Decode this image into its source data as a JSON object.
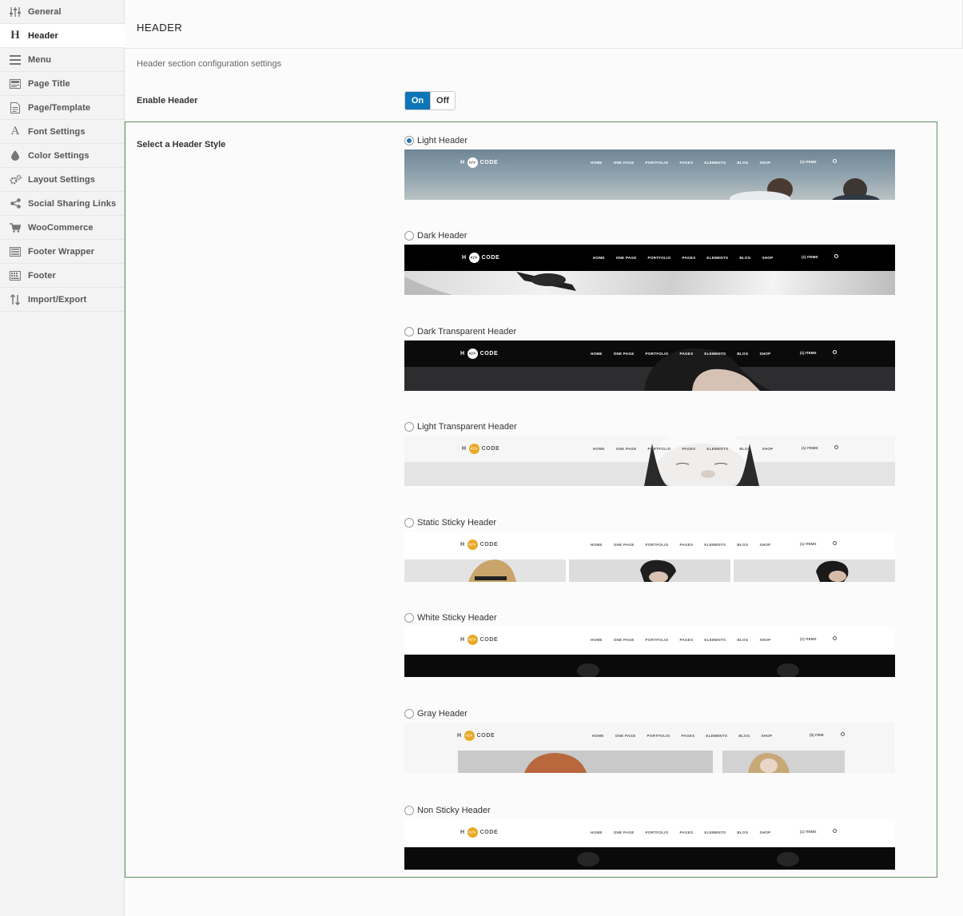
{
  "sidebar": {
    "items": [
      {
        "label": "General",
        "icon": "sliders-icon"
      },
      {
        "label": "Header",
        "icon": "h-icon"
      },
      {
        "label": "Menu",
        "icon": "menu-icon"
      },
      {
        "label": "Page Title",
        "icon": "page-title-icon"
      },
      {
        "label": "Page/Template",
        "icon": "document-icon"
      },
      {
        "label": "Font Settings",
        "icon": "font-icon"
      },
      {
        "label": "Color Settings",
        "icon": "droplet-icon"
      },
      {
        "label": "Layout Settings",
        "icon": "gears-icon"
      },
      {
        "label": "Social Sharing Links",
        "icon": "share-icon"
      },
      {
        "label": "WooCommerce",
        "icon": "cart-icon"
      },
      {
        "label": "Footer Wrapper",
        "icon": "footer-wrapper-icon"
      },
      {
        "label": "Footer",
        "icon": "footer-icon"
      },
      {
        "label": "Import/Export",
        "icon": "import-export-icon"
      }
    ],
    "active": "Header"
  },
  "main": {
    "title": "HEADER",
    "description": "Header section configuration settings",
    "enable_header": {
      "label": "Enable Header",
      "on": "On",
      "off": "Off",
      "value": "On"
    },
    "header_style": {
      "label": "Select a Header Style",
      "selected": "Light Header",
      "options": [
        {
          "label": "Light Header"
        },
        {
          "label": "Dark Header"
        },
        {
          "label": "Dark Transparent Header"
        },
        {
          "label": "Light Transparent Header"
        },
        {
          "label": "Static Sticky Header"
        },
        {
          "label": "White Sticky Header"
        },
        {
          "label": "Gray Header"
        },
        {
          "label": "Non Sticky Header"
        }
      ]
    }
  },
  "preview": {
    "logo_h": "H",
    "logo_code": "CODE",
    "logo_glyph": "</>",
    "nav": [
      "HOME",
      "ONE PAGE",
      "PORTFOLIO",
      "PAGES",
      "ELEMENTS",
      "BLOG",
      "SHOP"
    ],
    "cart": "(1) ITEMS",
    "cart_gray": "(0) ITEM"
  },
  "colors": {
    "accent": "#0e76b7",
    "frame": "#5f8e5f",
    "logo_gold": "#e8a926"
  }
}
